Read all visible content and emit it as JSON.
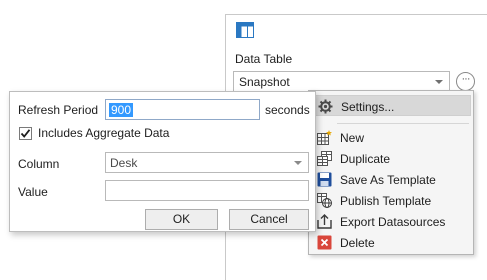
{
  "panel": {
    "label": "Data Table",
    "select_value": "Snapshot",
    "more_label": "···"
  },
  "menu": {
    "items": [
      {
        "label": "Settings...",
        "icon": "gear-icon"
      },
      {
        "label": "New",
        "icon": "new-table-icon"
      },
      {
        "label": "Duplicate",
        "icon": "duplicate-icon"
      },
      {
        "label": "Save As Template",
        "icon": "save-icon"
      },
      {
        "label": "Publish Template",
        "icon": "publish-globe-icon"
      },
      {
        "label": "Export Datasources",
        "icon": "export-icon"
      },
      {
        "label": "Delete",
        "icon": "delete-icon"
      }
    ]
  },
  "dialog": {
    "refresh_label": "Refresh Period",
    "refresh_value": "900",
    "refresh_unit": "seconds",
    "aggregate_label": "Includes Aggregate Data",
    "aggregate_checked": true,
    "column_label": "Column",
    "column_value": "Desk",
    "value_label": "Value",
    "value_value": "",
    "ok_label": "OK",
    "cancel_label": "Cancel"
  },
  "colors": {
    "accent": "#3399ff",
    "menu_highlight": "#d8d8d8",
    "delete_red": "#d9463b",
    "save_blue": "#1f4e9c"
  }
}
